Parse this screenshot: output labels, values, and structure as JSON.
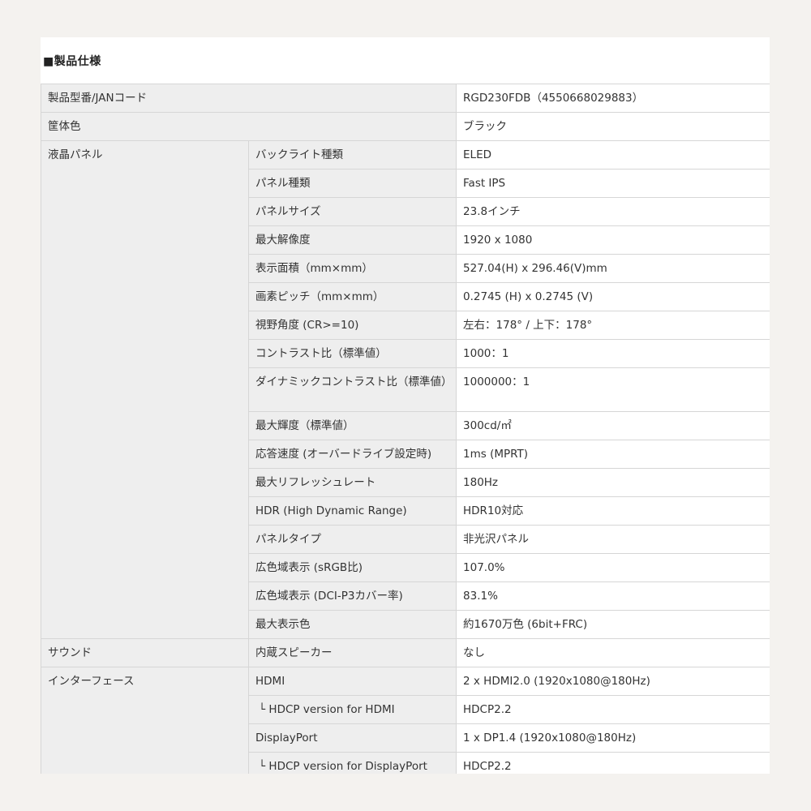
{
  "heading": "■製品仕様",
  "rows": [
    {
      "cat": "製品型番/JANコード",
      "val": "RGD230FDB（4550668029883）"
    },
    {
      "cat": "筐体色",
      "val": "ブラック"
    },
    {
      "cat": "液晶パネル",
      "sub": "バックライト種類",
      "val": "ELED"
    },
    {
      "sub": "パネル種類",
      "val": "Fast IPS"
    },
    {
      "sub": "パネルサイズ",
      "val": "23.8インチ"
    },
    {
      "sub": "最大解像度",
      "val": "1920 x 1080"
    },
    {
      "sub": "表示面積（mm×mm）",
      "val": "527.04(H) x 296.46(V)mm"
    },
    {
      "sub": "画素ピッチ（mm×mm）",
      "val": "0.2745 (H) x 0.2745 (V)"
    },
    {
      "sub": "視野角度 (CR>=10)",
      "val": "左右：178° / 上下：178°"
    },
    {
      "sub": "コントラスト比（標準値）",
      "val": "1000：1"
    },
    {
      "sub": "ダイナミックコントラスト比（標準値）",
      "val": "1000000：1"
    },
    {
      "sub": "最大輝度（標準値）",
      "val": "300cd/㎡"
    },
    {
      "sub": "応答速度 (オーバードライブ設定時)",
      "val": "1ms (MPRT)"
    },
    {
      "sub": "最大リフレッシュレート",
      "val": "180Hz"
    },
    {
      "sub": "HDR (High Dynamic Range)",
      "val": "HDR10対応"
    },
    {
      "sub": "パネルタイプ",
      "val": "非光沢パネル"
    },
    {
      "sub": "広色域表示 (sRGB比)",
      "val": "107.0%"
    },
    {
      "sub": "広色域表示 (DCI-P3カバー率)",
      "val": "83.1%"
    },
    {
      "sub": "最大表示色",
      "val": "約1670万色 (6bit+FRC)"
    },
    {
      "cat": "サウンド",
      "sub": "内蔵スピーカー",
      "val": "なし"
    },
    {
      "cat": "インターフェース",
      "sub": "HDMI",
      "val": "2 x HDMI2.0 (1920x1080@180Hz)"
    },
    {
      "sub": "└ HDCP version for HDMI",
      "val": "HDCP2.2"
    },
    {
      "sub": "DisplayPort",
      "val": "1 x DP1.4 (1920x1080@180Hz)"
    },
    {
      "sub": "└ HDCP version for DisplayPort",
      "val": "HDCP2.2"
    },
    {
      "sub": "",
      "val": ""
    }
  ]
}
